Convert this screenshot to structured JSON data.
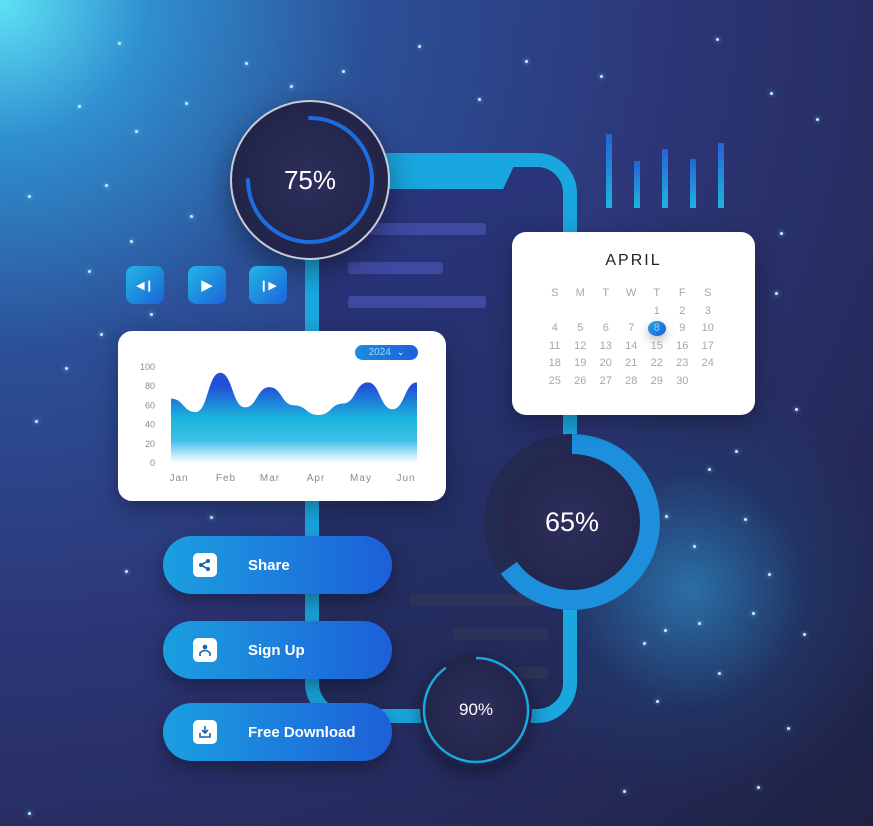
{
  "progress": {
    "top": {
      "label": "75%",
      "value": 0.75
    },
    "middle": {
      "label": "65%",
      "value": 0.65
    },
    "bottom": {
      "label": "90%",
      "value": 0.9
    }
  },
  "media_controls": {
    "prev_icon": "◀❙",
    "play_icon": "▶",
    "next_icon": "❙▶"
  },
  "calendar": {
    "month": "APRIL",
    "weekdays": [
      "S",
      "M",
      "T",
      "W",
      "T",
      "F",
      "S"
    ],
    "leading_blanks": 4,
    "days": 30,
    "selected_day": 8
  },
  "chart": {
    "year_select": "2024",
    "chevron": "⌄"
  },
  "chart_data": {
    "type": "area",
    "title": "",
    "categories": [
      "Jan",
      "Feb",
      "Mar",
      "Apr",
      "May",
      "Jun"
    ],
    "x": [
      0,
      0.5,
      1,
      1.5,
      2,
      2.5,
      3,
      3.5,
      4,
      4.5,
      5
    ],
    "values": [
      67,
      53,
      94,
      58,
      79,
      60,
      50,
      62,
      84,
      56,
      84
    ],
    "yticks": [
      0,
      20,
      40,
      60,
      80,
      100
    ],
    "ylim": [
      0,
      100
    ],
    "xlabel": "",
    "ylabel": "",
    "grid": false,
    "legend": "none"
  },
  "buttons": [
    {
      "label": "Share",
      "icon": "share-icon"
    },
    {
      "label": "Sign Up",
      "icon": "user-icon"
    },
    {
      "label": "Free Download",
      "icon": "download-icon"
    }
  ],
  "decor_bars": [
    1.0,
    0.64,
    0.8,
    0.66,
    0.88
  ],
  "colors": {
    "accent": "#1aa6de",
    "accent_dark": "#1d5fd9",
    "card": "#ffffff"
  }
}
